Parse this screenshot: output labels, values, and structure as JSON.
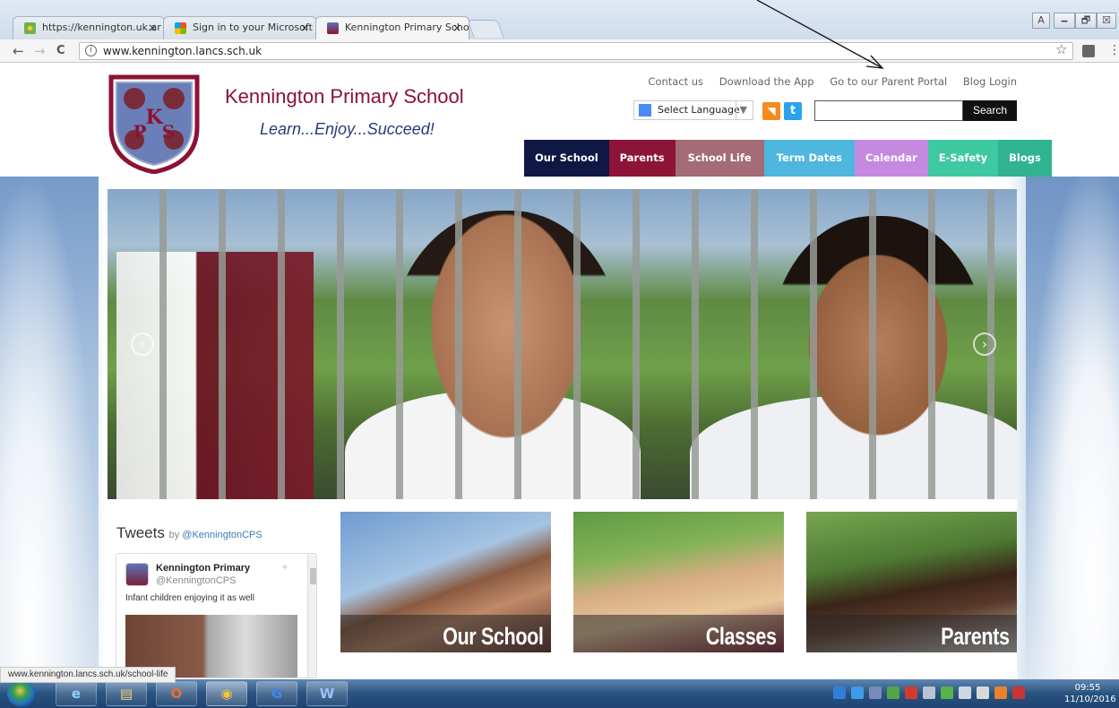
{
  "browser": {
    "tabs": [
      {
        "label": "https://kennington.uk.ar",
        "close": "×"
      },
      {
        "label": "Sign in to your Microsoft",
        "close": "×"
      },
      {
        "label": "Kennington Primary Scho",
        "close": "×"
      }
    ],
    "nav": {
      "back": "←",
      "forward": "→",
      "reload": "C"
    },
    "address": "www.kennington.lancs.sch.uk",
    "info_glyph": "i",
    "star_glyph": "☆",
    "menu_glyph": "⋮",
    "window_controls": [
      "🗕",
      "🗗",
      "☒"
    ]
  },
  "site": {
    "title": "Kennington Primary School",
    "tagline": "Learn...Enjoy...Succeed!",
    "logo_letters": [
      "K",
      "P",
      "S"
    ],
    "top_links": [
      "Contact us",
      "Download the App",
      "Go to our Parent Portal",
      "Blog Login"
    ],
    "language_select": "Select Language",
    "language_caret": "▼",
    "rss_glyph": "◥",
    "twitter_glyph": "t",
    "search_button": "Search",
    "search_placeholder": "",
    "nav": [
      {
        "label": "Our School",
        "color": "#0f1845"
      },
      {
        "label": "Parents",
        "color": "#8c1537"
      },
      {
        "label": "School Life",
        "color": "#a36c76"
      },
      {
        "label": "Term Dates",
        "color": "#4fb6dd"
      },
      {
        "label": "Calendar",
        "color": "#c58ae0"
      },
      {
        "label": "E-Safety",
        "color": "#3fc9a1"
      },
      {
        "label": "Blogs",
        "color": "#2fb48f"
      }
    ],
    "slider": {
      "prev": "‹",
      "next": "›"
    },
    "tweets": {
      "heading": "Tweets",
      "by": "by",
      "by_handle": "@KenningtonCPS",
      "account_name": "Kennington Primary",
      "account_handle": "@KenningtonCPS",
      "bird_glyph": "✦",
      "text": "Infant children enjoying it as well"
    },
    "tiles": [
      {
        "label": "Our School"
      },
      {
        "label": "Classes"
      },
      {
        "label": "Parents"
      }
    ]
  },
  "status_url": "www.kennington.lancs.sch.uk/school-life",
  "taskbar": {
    "apps": [
      "e",
      "▤",
      "O",
      "◉",
      "G",
      "W"
    ],
    "time": "09:55",
    "date": "11/10/2016"
  }
}
